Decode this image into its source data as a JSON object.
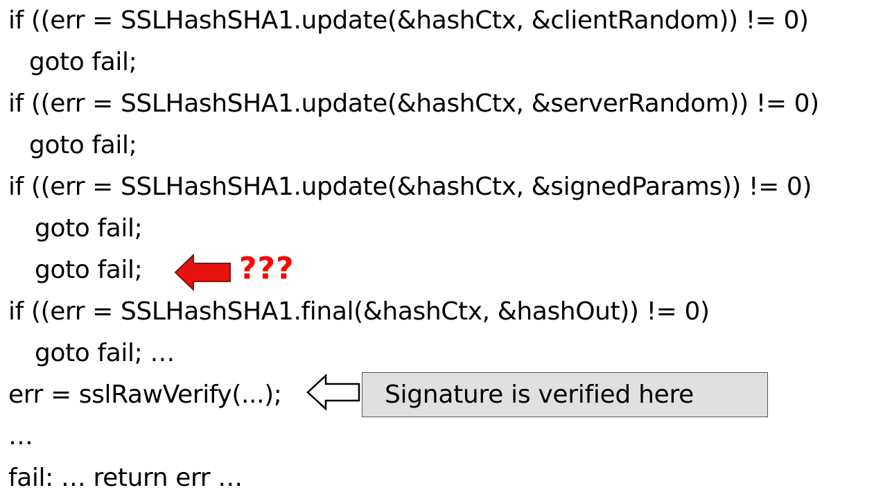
{
  "code_lines": [
    "if ((err = SSLHashSHA1.update(&hashCtx, &clientRandom)) != 0)",
    "goto fail;",
    "if ((err = SSLHashSHA1.update(&hashCtx, &serverRandom)) != 0)",
    "goto fail;",
    "if ((err = SSLHashSHA1.update(&hashCtx, &signedParams)) != 0)",
    "goto fail;",
    "goto fail;",
    "if ((err = SSLHashSHA1.final(&hashCtx, &hashOut)) != 0)",
    "goto fail; …",
    "err = sslRawVerify(...);",
    "…",
    "fail: … return err …"
  ],
  "annotations": {
    "question_marks": "???",
    "callout_text": "Signature is verified here"
  },
  "colors": {
    "red_arrow_fill": "#e8130f",
    "question_marks": "#ff0000",
    "callout_background": "#e0e0e0"
  },
  "icons": {
    "duplicate_line_marker": "red-arrow-left-icon",
    "verify_line_marker": "white-arrow-left-icon"
  }
}
